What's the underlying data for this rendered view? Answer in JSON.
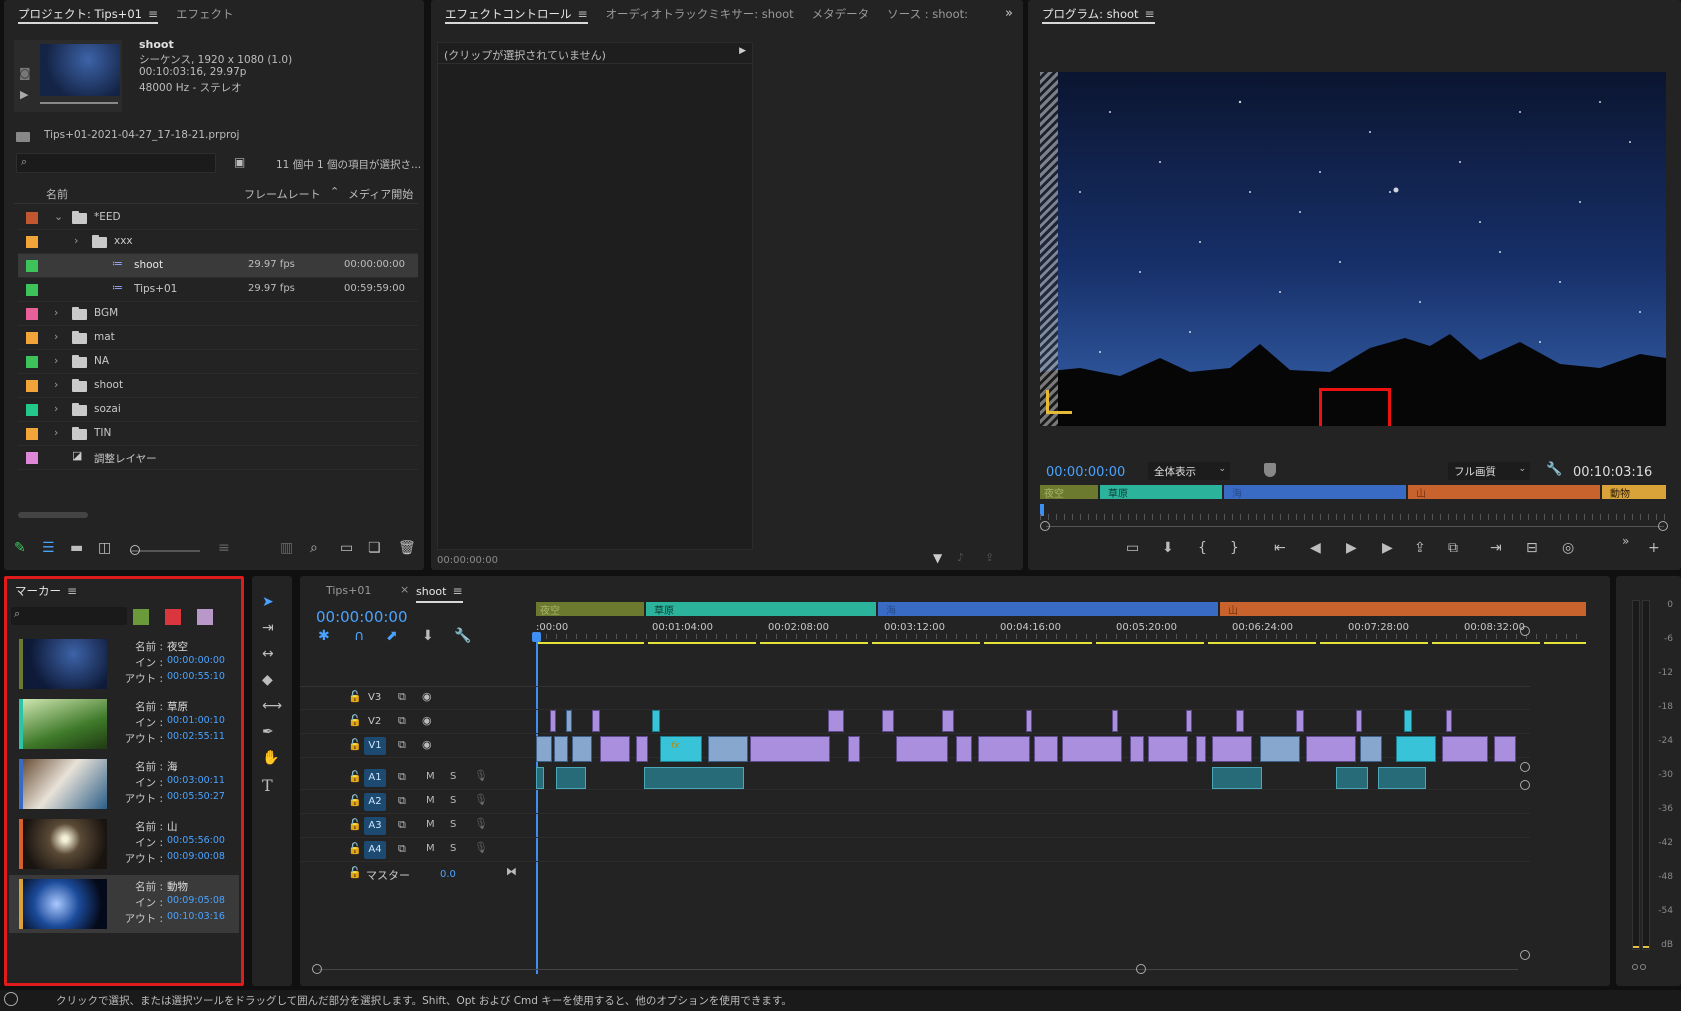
{
  "project": {
    "tabs": [
      "プロジェクト: Tips+01",
      "エフェクト"
    ],
    "clip_name": "shoot",
    "clip_info": [
      "シーケンス, 1920 x 1080 (1.0)",
      "00:10:03:16, 29.97p",
      "48000 Hz - ステレオ"
    ],
    "proj_file": "Tips+01-2021-04-27_17-18-21.prproj",
    "selection_info": "11 個中 1 個の項目が選択さ...",
    "columns": [
      "名前",
      "フレームレート",
      "メディア開始"
    ],
    "items": [
      {
        "name": "*EED",
        "color": "#c0572e",
        "fps": "",
        "start": ""
      },
      {
        "name": "xxx",
        "color": "#f2a33a",
        "fps": "",
        "start": ""
      },
      {
        "name": "shoot",
        "color": "#3cc45a",
        "fps": "29.97 fps",
        "start": "00:00:00:00"
      },
      {
        "name": "Tips+01",
        "color": "#3cc45a",
        "fps": "29.97 fps",
        "start": "00:59:59:00"
      },
      {
        "name": "BGM",
        "color": "#e8609a",
        "fps": "",
        "start": ""
      },
      {
        "name": "mat",
        "color": "#f2a33a",
        "fps": "",
        "start": ""
      },
      {
        "name": "NA",
        "color": "#3cc45a",
        "fps": "",
        "start": ""
      },
      {
        "name": "shoot",
        "color": "#f2a33a",
        "fps": "",
        "start": ""
      },
      {
        "name": "sozai",
        "color": "#22c98a",
        "fps": "",
        "start": ""
      },
      {
        "name": "TIN",
        "color": "#f2a33a",
        "fps": "",
        "start": ""
      },
      {
        "name": "調整レイヤー",
        "color": "#e088d8",
        "fps": "",
        "start": ""
      }
    ]
  },
  "effects": {
    "tabs": [
      "エフェクトコントロール",
      "オーディオトラックミキサー: shoot",
      "メタデータ",
      "ソース : shoot:"
    ],
    "no_clip": "(クリップが選択されていません)",
    "timecode": "00:00:00:00"
  },
  "program": {
    "tab": "プログラム: shoot",
    "timecode": "00:00:00:00",
    "zoom": "全体表示",
    "quality": "フル画質",
    "duration": "00:10:03:16",
    "markers": [
      {
        "label": "夜空",
        "color": "#6b7a2e"
      },
      {
        "label": "草原",
        "color": "#2bb39c"
      },
      {
        "label": "海",
        "color": "#3a6bc4"
      },
      {
        "label": "山",
        "color": "#c8632e"
      },
      {
        "label": "動物",
        "color": "#d9a33a"
      }
    ]
  },
  "markers_panel": {
    "title": "マーカー",
    "label_name": "名前 :",
    "label_in": "イン :",
    "label_out": "アウト :",
    "items": [
      {
        "name": "夜空",
        "in": "00:00:00:00",
        "out": "00:00:55:10",
        "color": "#6b7a2e"
      },
      {
        "name": "草原",
        "in": "00:01:00:10",
        "out": "00:02:55:11",
        "color": "#2bc4a8"
      },
      {
        "name": "海",
        "in": "00:03:00:11",
        "out": "00:05:50:27",
        "color": "#3a6bc4"
      },
      {
        "name": "山",
        "in": "00:05:56:00",
        "out": "00:09:00:08",
        "color": "#d8602e"
      },
      {
        "name": "動物",
        "in": "00:09:05:08",
        "out": "00:10:03:16",
        "color": "#d9a33a"
      }
    ]
  },
  "timeline": {
    "tabs": [
      "Tips+01",
      "shoot"
    ],
    "timecode": "00:00:00:00",
    "ruler": [
      ":00:00",
      "00:01:04:00",
      "00:02:08:00",
      "00:03:12:00",
      "00:04:16:00",
      "00:05:20:00",
      "00:06:24:00",
      "00:07:28:00",
      "00:08:32:00"
    ],
    "marker_labels": [
      "夜空",
      "草原",
      "海",
      "山"
    ],
    "video_tracks": [
      "V3",
      "V2",
      "V1"
    ],
    "audio_tracks": [
      "A1",
      "A2",
      "A3",
      "A4"
    ],
    "master_label": "マスター",
    "master_value": "0.0",
    "m": "M",
    "s": "S"
  },
  "meter": {
    "ticks": [
      "0",
      "-6",
      "-12",
      "-18",
      "-24",
      "-30",
      "-36",
      "-42",
      "-48",
      "-54",
      "dB"
    ]
  },
  "status_bar": "クリックで選択、または選択ツールをドラッグして囲んだ部分を選択します。Shift、Opt および Cmd キーを使用すると、他のオプションを使用できます。"
}
